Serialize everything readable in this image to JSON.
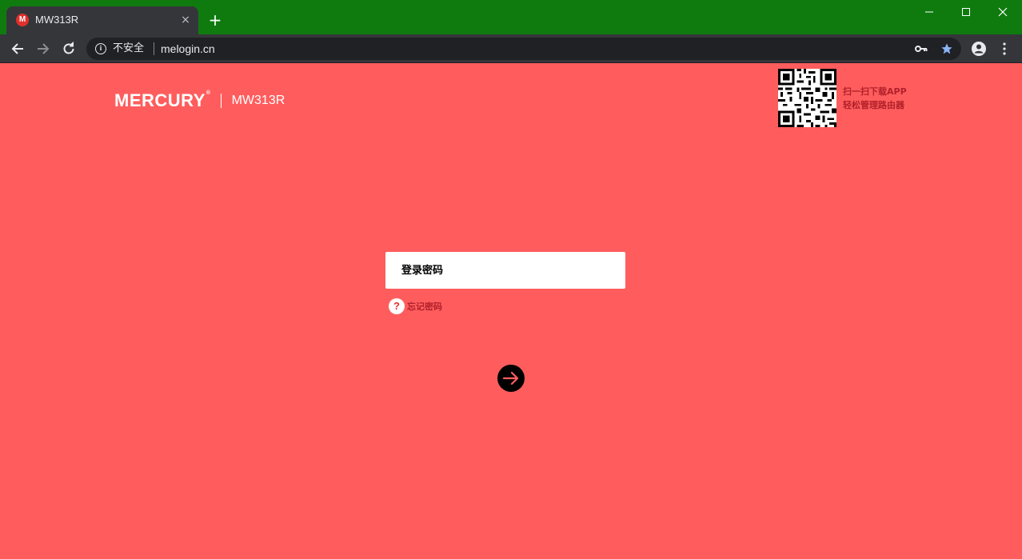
{
  "browser": {
    "tab": {
      "favicon": "M",
      "title": "MW313R",
      "close_icon": "×"
    },
    "new_tab_icon": "+",
    "omnibox": {
      "security_label": "不安全",
      "url": "melogin.cn"
    },
    "icons": {
      "back": "arrow-left-icon",
      "forward": "arrow-right-icon",
      "reload": "reload-icon",
      "key": "key-icon",
      "bookmark": "star-icon",
      "profile": "account-icon",
      "menu": "more-vert-icon",
      "minimize": "minimize-icon",
      "maximize": "maximize-icon",
      "close": "close-icon"
    },
    "colors": {
      "titlebar": "#0f7b0f",
      "toolbar": "#35363a",
      "star": "#8ab4f8"
    }
  },
  "header": {
    "brand": "MERCURY",
    "brand_mark": "®",
    "model": "MW313R"
  },
  "qr_promo": {
    "line1": "扫一扫下载APP",
    "line2": "轻松管理路由器"
  },
  "login": {
    "password_placeholder": "登录密码",
    "password_value": "",
    "forgot_icon": "?",
    "forgot_label": "忘记密码",
    "submit_icon": "arrow-right-icon"
  },
  "colors": {
    "page_background": "#ff5d5d",
    "accent_text": "#b2202a",
    "button": "#000000"
  }
}
